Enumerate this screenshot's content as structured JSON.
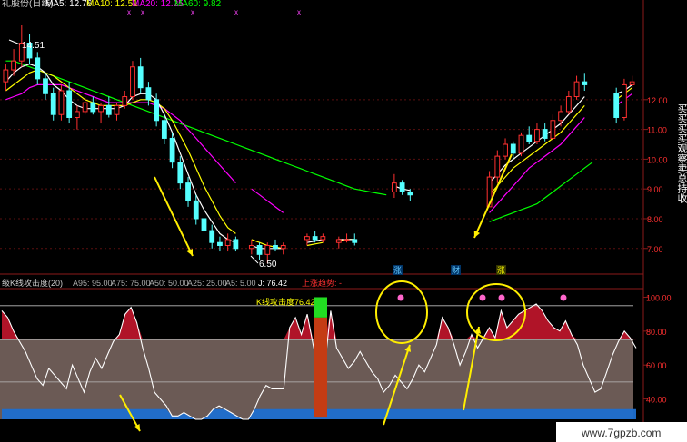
{
  "header": {
    "title": "礼股份(日线)",
    "ma_items": [
      {
        "label": "MA5: 12.76",
        "color": "#ffffff"
      },
      {
        "label": "MA10: 12.51",
        "color": "#ffff00"
      },
      {
        "label": "MA20: 12.25",
        "color": "#ff00ff"
      },
      {
        "label": "MA60: 9.82",
        "color": "#00ff00"
      }
    ]
  },
  "annotations": {
    "high_label": "14.51",
    "low_label": "6.50",
    "watermark": "www.7gpzb.com"
  },
  "right_vertical_text": "买买买买观察卖总持收",
  "indicator": {
    "name": "级K线攻击度(20)",
    "params": [
      "A95: 95.00",
      "A75: 75.00",
      "A50: 50.00",
      "A25: 25.00",
      "A5: 5.00"
    ],
    "j_label": "J: 76.42",
    "trend_label": "上涨趋势: -",
    "attack_label": "K线攻击度76.42",
    "markers": [
      "涨",
      "财",
      "涨"
    ]
  },
  "chart_data": [
    {
      "type": "candlestick",
      "title": "礼股份(日线)",
      "y_ticks": [
        "12.00",
        "11.00",
        "10.00",
        "9.00",
        "8.00",
        "7.00"
      ],
      "ylim": [
        6.2,
        14.8
      ],
      "colors": {
        "up": "#ff3030",
        "down": "#55ffff",
        "ma5": "#ffffff",
        "ma10": "#ffff00",
        "ma20": "#ff00ff",
        "ma60": "#00ff00"
      },
      "candles": [
        [
          12.6,
          13.2,
          12.3,
          13.0
        ],
        [
          13.0,
          13.7,
          12.8,
          13.3
        ],
        [
          13.3,
          14.51,
          13.1,
          13.9
        ],
        [
          13.9,
          14.2,
          13.2,
          13.4
        ],
        [
          13.4,
          13.6,
          12.5,
          12.7
        ],
        [
          12.7,
          12.9,
          12.0,
          12.2
        ],
        [
          12.2,
          12.4,
          11.3,
          11.5
        ],
        [
          11.5,
          12.5,
          11.3,
          12.3
        ],
        [
          12.3,
          12.6,
          11.2,
          11.4
        ],
        [
          11.4,
          11.8,
          11.0,
          11.6
        ],
        [
          11.6,
          12.1,
          11.5,
          11.9
        ],
        [
          11.9,
          12.1,
          11.5,
          11.6
        ],
        [
          11.6,
          11.9,
          11.2,
          11.8
        ],
        [
          11.8,
          12.1,
          11.4,
          11.5
        ],
        [
          11.5,
          11.9,
          11.3,
          11.8
        ],
        [
          11.8,
          12.3,
          11.7,
          12.1
        ],
        [
          12.1,
          13.3,
          12.0,
          13.1
        ],
        [
          13.1,
          13.4,
          12.2,
          12.4
        ],
        [
          12.4,
          12.6,
          11.8,
          12.0
        ],
        [
          12.0,
          12.2,
          11.1,
          11.3
        ],
        [
          11.3,
          11.5,
          10.5,
          10.7
        ],
        [
          10.7,
          10.9,
          9.7,
          9.9
        ],
        [
          9.9,
          10.1,
          9.0,
          9.2
        ],
        [
          9.2,
          9.4,
          8.4,
          8.6
        ],
        [
          8.6,
          8.8,
          7.8,
          8.0
        ],
        [
          8.0,
          8.2,
          7.4,
          7.6
        ],
        [
          7.6,
          7.8,
          7.0,
          7.2
        ],
        [
          7.2,
          7.4,
          6.9,
          7.1
        ],
        [
          7.1,
          7.5,
          6.9,
          7.3
        ],
        [
          7.3,
          7.4,
          6.9,
          7.0
        ],
        [
          null
        ],
        [
          7.0,
          7.3,
          6.8,
          7.1
        ],
        [
          7.1,
          7.2,
          6.6,
          6.8
        ],
        [
          6.8,
          7.2,
          6.5,
          7.1
        ],
        [
          7.1,
          7.3,
          6.9,
          7.0
        ],
        [
          7.0,
          7.2,
          6.8,
          7.1
        ],
        [
          null
        ],
        [
          null
        ],
        [
          7.3,
          7.5,
          7.1,
          7.4
        ],
        [
          7.4,
          7.6,
          7.2,
          7.3
        ],
        [
          7.3,
          7.5,
          7.2,
          7.4
        ],
        [
          null
        ],
        [
          7.2,
          7.4,
          7.0,
          7.3
        ],
        [
          7.3,
          7.5,
          7.2,
          7.3
        ],
        [
          7.3,
          7.5,
          7.1,
          7.2
        ],
        [
          null
        ],
        [
          null
        ],
        [
          null
        ],
        [
          null
        ],
        [
          8.9,
          9.5,
          8.7,
          9.2
        ],
        [
          9.2,
          9.3,
          8.8,
          8.9
        ],
        [
          8.9,
          9.0,
          8.6,
          8.8
        ],
        [
          null
        ],
        [
          null
        ],
        [
          null
        ],
        [
          null
        ],
        [
          null
        ],
        [
          null
        ],
        [
          null
        ],
        [
          null
        ],
        [
          null
        ],
        [
          8.4,
          9.6,
          8.4,
          9.4
        ],
        [
          9.4,
          10.3,
          9.2,
          10.1
        ],
        [
          10.1,
          10.7,
          10.0,
          10.5
        ],
        [
          10.5,
          10.6,
          10.0,
          10.2
        ],
        [
          10.2,
          10.9,
          10.1,
          10.8
        ],
        [
          10.8,
          11.1,
          10.5,
          10.6
        ],
        [
          10.6,
          11.2,
          10.5,
          11.0
        ],
        [
          11.0,
          11.2,
          10.6,
          10.7
        ],
        [
          10.7,
          11.5,
          10.6,
          11.3
        ],
        [
          11.3,
          11.8,
          11.1,
          11.6
        ],
        [
          11.6,
          12.3,
          11.5,
          12.1
        ],
        [
          12.1,
          12.8,
          12.0,
          12.6
        ],
        [
          12.6,
          12.9,
          12.3,
          12.5
        ],
        [
          null
        ],
        [
          null
        ],
        [
          null
        ],
        [
          12.2,
          12.4,
          11.2,
          11.4
        ],
        [
          11.4,
          12.7,
          11.3,
          12.5
        ],
        [
          12.5,
          12.8,
          12.4,
          12.6
        ]
      ],
      "ma5": [
        12.6,
        12.9,
        13.1,
        13.2,
        13.1,
        12.9,
        12.5,
        12.3,
        12.0,
        11.8,
        11.7,
        11.7,
        11.7,
        11.7,
        11.7,
        11.8,
        12.1,
        12.2,
        12.2,
        12.0,
        11.5,
        10.9,
        10.2,
        9.5,
        8.8,
        8.3,
        7.9,
        7.5,
        7.3,
        7.2,
        null,
        7.1,
        7.0,
        7.0,
        7.0,
        7.0,
        null,
        null,
        7.2,
        7.25,
        7.3,
        null,
        7.3,
        7.3,
        7.3,
        null,
        null,
        null,
        null,
        9.1,
        9.0,
        8.95,
        null,
        null,
        null,
        null,
        null,
        null,
        null,
        null,
        null,
        9.2,
        9.5,
        9.8,
        10.0,
        10.2,
        10.4,
        10.6,
        10.8,
        11.0,
        11.2,
        11.5,
        11.8,
        12.1,
        null,
        null,
        null,
        12.2,
        12.3,
        12.5
      ],
      "ma10": [
        12.3,
        12.5,
        12.7,
        12.9,
        13.0,
        12.9,
        12.8,
        12.6,
        12.4,
        12.2,
        12.0,
        11.9,
        11.8,
        11.8,
        11.8,
        11.8,
        11.9,
        12.0,
        12.0,
        11.9,
        11.7,
        11.3,
        10.8,
        10.3,
        9.7,
        9.1,
        8.6,
        8.1,
        7.7,
        7.5,
        null,
        7.3,
        7.2,
        7.1,
        7.05,
        7.0,
        null,
        null,
        7.1,
        7.15,
        7.2,
        null,
        7.25,
        7.3,
        7.3,
        null,
        null,
        null,
        null,
        null,
        null,
        null,
        null,
        null,
        null,
        null,
        null,
        null,
        null,
        null,
        null,
        8.8,
        9.1,
        9.4,
        9.7,
        9.9,
        10.1,
        10.3,
        10.5,
        10.7,
        10.9,
        11.2,
        11.5,
        11.8,
        null,
        null,
        null,
        12.0,
        12.2,
        12.4
      ],
      "ma20": [
        12.0,
        12.1,
        12.2,
        12.4,
        12.5,
        12.5,
        12.5,
        12.5,
        12.4,
        12.3,
        12.2,
        12.1,
        12.0,
        11.9,
        11.9,
        11.9,
        11.9,
        11.9,
        11.9,
        11.8,
        11.7,
        11.5,
        11.3,
        11.0,
        10.7,
        10.4,
        10.1,
        9.8,
        9.5,
        9.2,
        null,
        9.0,
        8.8,
        8.6,
        8.4,
        8.2,
        null,
        null,
        null,
        null,
        null,
        null,
        null,
        null,
        null,
        null,
        null,
        null,
        null,
        null,
        null,
        null,
        null,
        null,
        null,
        null,
        null,
        null,
        null,
        null,
        null,
        8.2,
        8.5,
        8.8,
        9.1,
        9.4,
        9.7,
        9.9,
        10.1,
        10.3,
        10.5,
        10.8,
        11.1,
        11.4,
        null,
        null,
        null,
        11.8,
        12.0,
        12.2
      ],
      "ma60": [
        13.3,
        13.3,
        13.2,
        13.1,
        13.0,
        12.9,
        12.8,
        12.7,
        12.6,
        12.5,
        12.4,
        12.3,
        12.2,
        12.1,
        12.0,
        11.9,
        11.8,
        11.7,
        11.6,
        11.5,
        11.4,
        11.3,
        11.2,
        11.1,
        11.0,
        10.9,
        10.8,
        10.7,
        10.6,
        10.5,
        10.4,
        10.3,
        10.2,
        10.1,
        10.0,
        9.9,
        9.8,
        9.7,
        9.6,
        9.5,
        9.4,
        9.3,
        9.2,
        9.1,
        9.0,
        8.95,
        8.9,
        8.85,
        8.8,
        null,
        null,
        null,
        null,
        null,
        null,
        null,
        null,
        null,
        null,
        null,
        null,
        7.9,
        8.0,
        8.1,
        8.2,
        8.3,
        8.4,
        8.5,
        8.7,
        8.9,
        9.1,
        9.3,
        9.5,
        9.7,
        9.9,
        null,
        null,
        null,
        null,
        null
      ]
    },
    {
      "type": "area",
      "title": "级K线攻击度(20)",
      "y_ticks": [
        "100.00",
        "80.00",
        "60.00",
        "40.00"
      ],
      "ylim": [
        28,
        104
      ],
      "levels": {
        "upper": 95,
        "band_top": 75,
        "mid": 50,
        "lower_band": 25,
        "floor": 5
      },
      "values": [
        92,
        88,
        80,
        74,
        68,
        60,
        52,
        48,
        58,
        54,
        50,
        46,
        60,
        52,
        44,
        56,
        64,
        58,
        66,
        74,
        78,
        90,
        94,
        85,
        70,
        58,
        44,
        40,
        36,
        30,
        30,
        32,
        30,
        28,
        28,
        30,
        34,
        36,
        34,
        32,
        30,
        28,
        28,
        34,
        42,
        48,
        46,
        46,
        46,
        82,
        88,
        78,
        90,
        72,
        56,
        60,
        92,
        70,
        64,
        58,
        62,
        68,
        62,
        56,
        52,
        44,
        48,
        54,
        50,
        46,
        52,
        60,
        56,
        64,
        72,
        88,
        82,
        72,
        60,
        68,
        78,
        70,
        76,
        82,
        76,
        92,
        82,
        86,
        90,
        92,
        94,
        96,
        92,
        86,
        82,
        80,
        86,
        78,
        72,
        60,
        52,
        44,
        46,
        56,
        66,
        74,
        80,
        76,
        70
      ],
      "attack_bar": {
        "green_from": 100,
        "green_to": 88,
        "red_to": 29
      }
    }
  ]
}
